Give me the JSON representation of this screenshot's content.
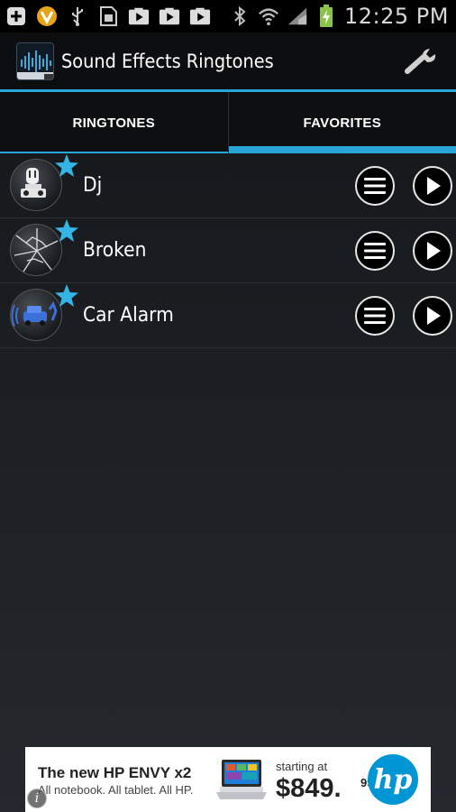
{
  "status_bar": {
    "time": "12:25 PM",
    "left_icons": [
      "add-icon",
      "v-badge-icon",
      "usb-icon",
      "sim-icon",
      "play-store-icon",
      "play-store-icon",
      "play-store-icon"
    ],
    "right_icons": [
      "bluetooth-icon",
      "wifi-icon",
      "signal-icon",
      "battery-charging-icon"
    ]
  },
  "app": {
    "title": "Sound Effects Ringtones",
    "settings_icon": "wrench-icon"
  },
  "tabs": [
    {
      "label": "RINGTONES",
      "selected": false
    },
    {
      "label": "FAVORITES",
      "selected": true
    }
  ],
  "ringtones": [
    {
      "name": "Dj",
      "thumb": "dj-robot",
      "favorite": true
    },
    {
      "name": "Broken",
      "thumb": "broken-glass",
      "favorite": true
    },
    {
      "name": "Car Alarm",
      "thumb": "car-alarm",
      "favorite": true
    }
  ],
  "ad": {
    "headline": "The new HP ENVY x2",
    "subline": "All notebook. All tablet. All HP.",
    "price_prefix": "starting at",
    "price": "$849.",
    "cents": "99",
    "logo": "hp"
  },
  "colors": {
    "accent": "#2aa6d9",
    "star": "#33b5e5",
    "battery": "#8bc34a"
  }
}
